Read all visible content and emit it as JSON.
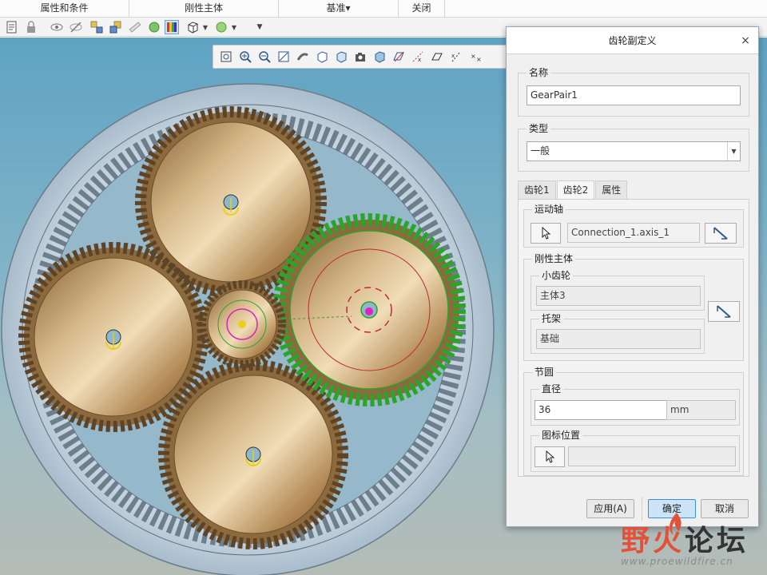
{
  "ribbon": {
    "groups": [
      "属性和条件",
      "刚性主体",
      "基准▾",
      "关闭"
    ]
  },
  "dialog": {
    "title": "齿轮副定义",
    "close_glyph": "×",
    "name_label": "名称",
    "name_value": "GearPair1",
    "type_label": "类型",
    "type_value": "一般",
    "tabs": [
      "齿轮1",
      "齿轮2",
      "属性"
    ],
    "active_tab": "齿轮2",
    "motion_axis_label": "运动轴",
    "motion_axis_value": "Connection_1.axis_1",
    "rigid_body_label": "刚性主体",
    "pinion_label": "小齿轮",
    "pinion_value": "主体3",
    "carrier_label": "托架",
    "carrier_value": "基础",
    "pitch_circle_label": "节圆",
    "diameter_label": "直径",
    "diameter_value": "36",
    "diameter_unit": "mm",
    "icon_position_label": "图标位置",
    "icon_position_value": "",
    "apply_label": "应用(A)",
    "ok_label": "确定",
    "cancel_label": "取消"
  },
  "watermark": {
    "text_a": "野火",
    "text_b": "论坛",
    "url": "www.proewildfire.cn"
  },
  "colors": {
    "accent": "#3c8fd7",
    "gear_bronze": "#b08c5a",
    "watermark_red": "#e0533a",
    "selection_green": "#2aa52a"
  }
}
